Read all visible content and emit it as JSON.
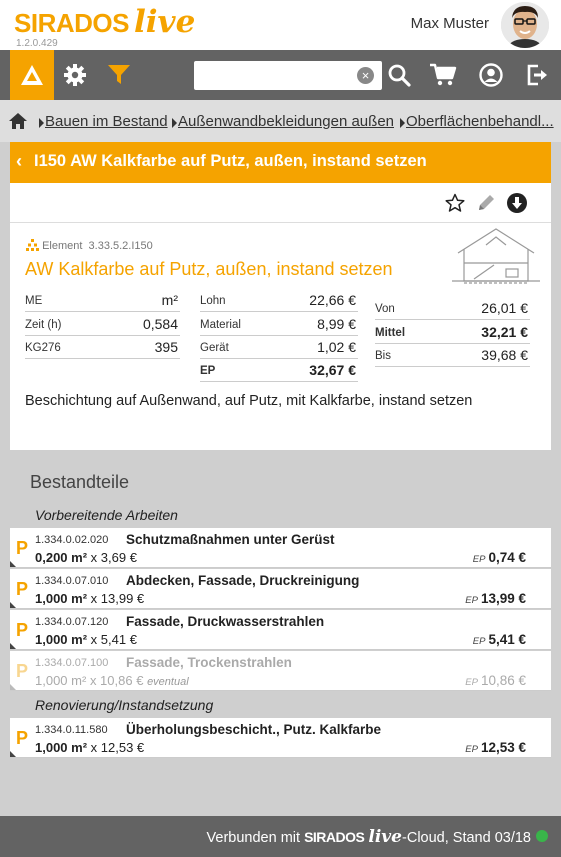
{
  "header": {
    "brand": "SIRADOS",
    "brand_suffix": "live",
    "version": "1.2.0.429",
    "user_name": "Max Muster"
  },
  "toolbar": {
    "search_value": "",
    "search_placeholder": ""
  },
  "breadcrumb": [
    {
      "label": "Bauen im Bestand"
    },
    {
      "label": "Außenwandbekleidungen außen"
    },
    {
      "label": "Oberflächenbehandl..."
    }
  ],
  "title_bar": {
    "title": "I150 AW Kalkfarbe auf Putz, außen, instand setzen"
  },
  "element": {
    "type_label": "Element",
    "code": "3.33.5.2.I150",
    "title": "AW Kalkfarbe auf Putz, außen, instand setzen",
    "col1": [
      {
        "label": "ME",
        "value": "m²"
      },
      {
        "label": "Zeit (h)",
        "value": "0,584"
      },
      {
        "label": "KG276",
        "value": "395"
      }
    ],
    "col2": [
      {
        "label": "Lohn",
        "value": "22,66 €"
      },
      {
        "label": "Material",
        "value": "8,99 €"
      },
      {
        "label": "Gerät",
        "value": "1,02 €"
      },
      {
        "label": "EP",
        "value": "32,67 €"
      }
    ],
    "col3": [
      {
        "label": "Von",
        "value": "26,01 €"
      },
      {
        "label": "Mittel",
        "value": "32,21 €"
      },
      {
        "label": "Bis",
        "value": "39,68 €"
      }
    ],
    "description": "Beschichtung auf Außenwand, auf Putz, mit Kalkfarbe, instand setzen"
  },
  "bestandteile": {
    "heading": "Bestandteile",
    "sections": [
      {
        "title": "Vorbereitende Arbeiten",
        "items": [
          {
            "marker": "P",
            "code": "1.334.0.02.020",
            "name": "Schutzmaßnahmen unter Gerüst",
            "qty": "0,200 m²",
            "price": "x 3,69 €",
            "optional": "",
            "ep_label": "EP",
            "ep": "0,74 €"
          },
          {
            "marker": "P",
            "code": "1.334.0.07.010",
            "name": "Abdecken, Fassade, Druckreinigung",
            "qty": "1,000 m²",
            "price": "x 13,99 €",
            "optional": "",
            "ep_label": "EP",
            "ep": "13,99 €"
          },
          {
            "marker": "P",
            "code": "1.334.0.07.120",
            "name": "Fassade, Druckwasserstrahlen",
            "qty": "1,000 m²",
            "price": "x 5,41 €",
            "optional": "",
            "ep_label": "EP",
            "ep": "5,41 €"
          },
          {
            "marker": "P",
            "code": "1.334.0.07.100",
            "name": "Fassade, Trockenstrahlen",
            "qty": "1,000 m²",
            "price": "x 10,86 €",
            "optional": "eventual",
            "ep_label": "EP",
            "ep": "10,86 €"
          }
        ]
      },
      {
        "title": "Renovierung/Instandsetzung",
        "items": [
          {
            "marker": "P",
            "code": "1.334.0.11.580",
            "name": "Überholungsbeschicht., Putz. Kalkfarbe",
            "qty": "1,000 m²",
            "price": "x 12,53 €",
            "optional": "",
            "ep_label": "EP",
            "ep": "12,53 €"
          }
        ]
      }
    ]
  },
  "footer": {
    "prefix": "Verbunden mit",
    "brand": "SIRADOS",
    "brand_suffix": "live",
    "suffix": "-Cloud, Stand 03/18",
    "status_color": "#39b54a"
  },
  "colors": {
    "accent": "#f5a300",
    "toolbar": "#636363",
    "background": "#cfcfcf"
  }
}
